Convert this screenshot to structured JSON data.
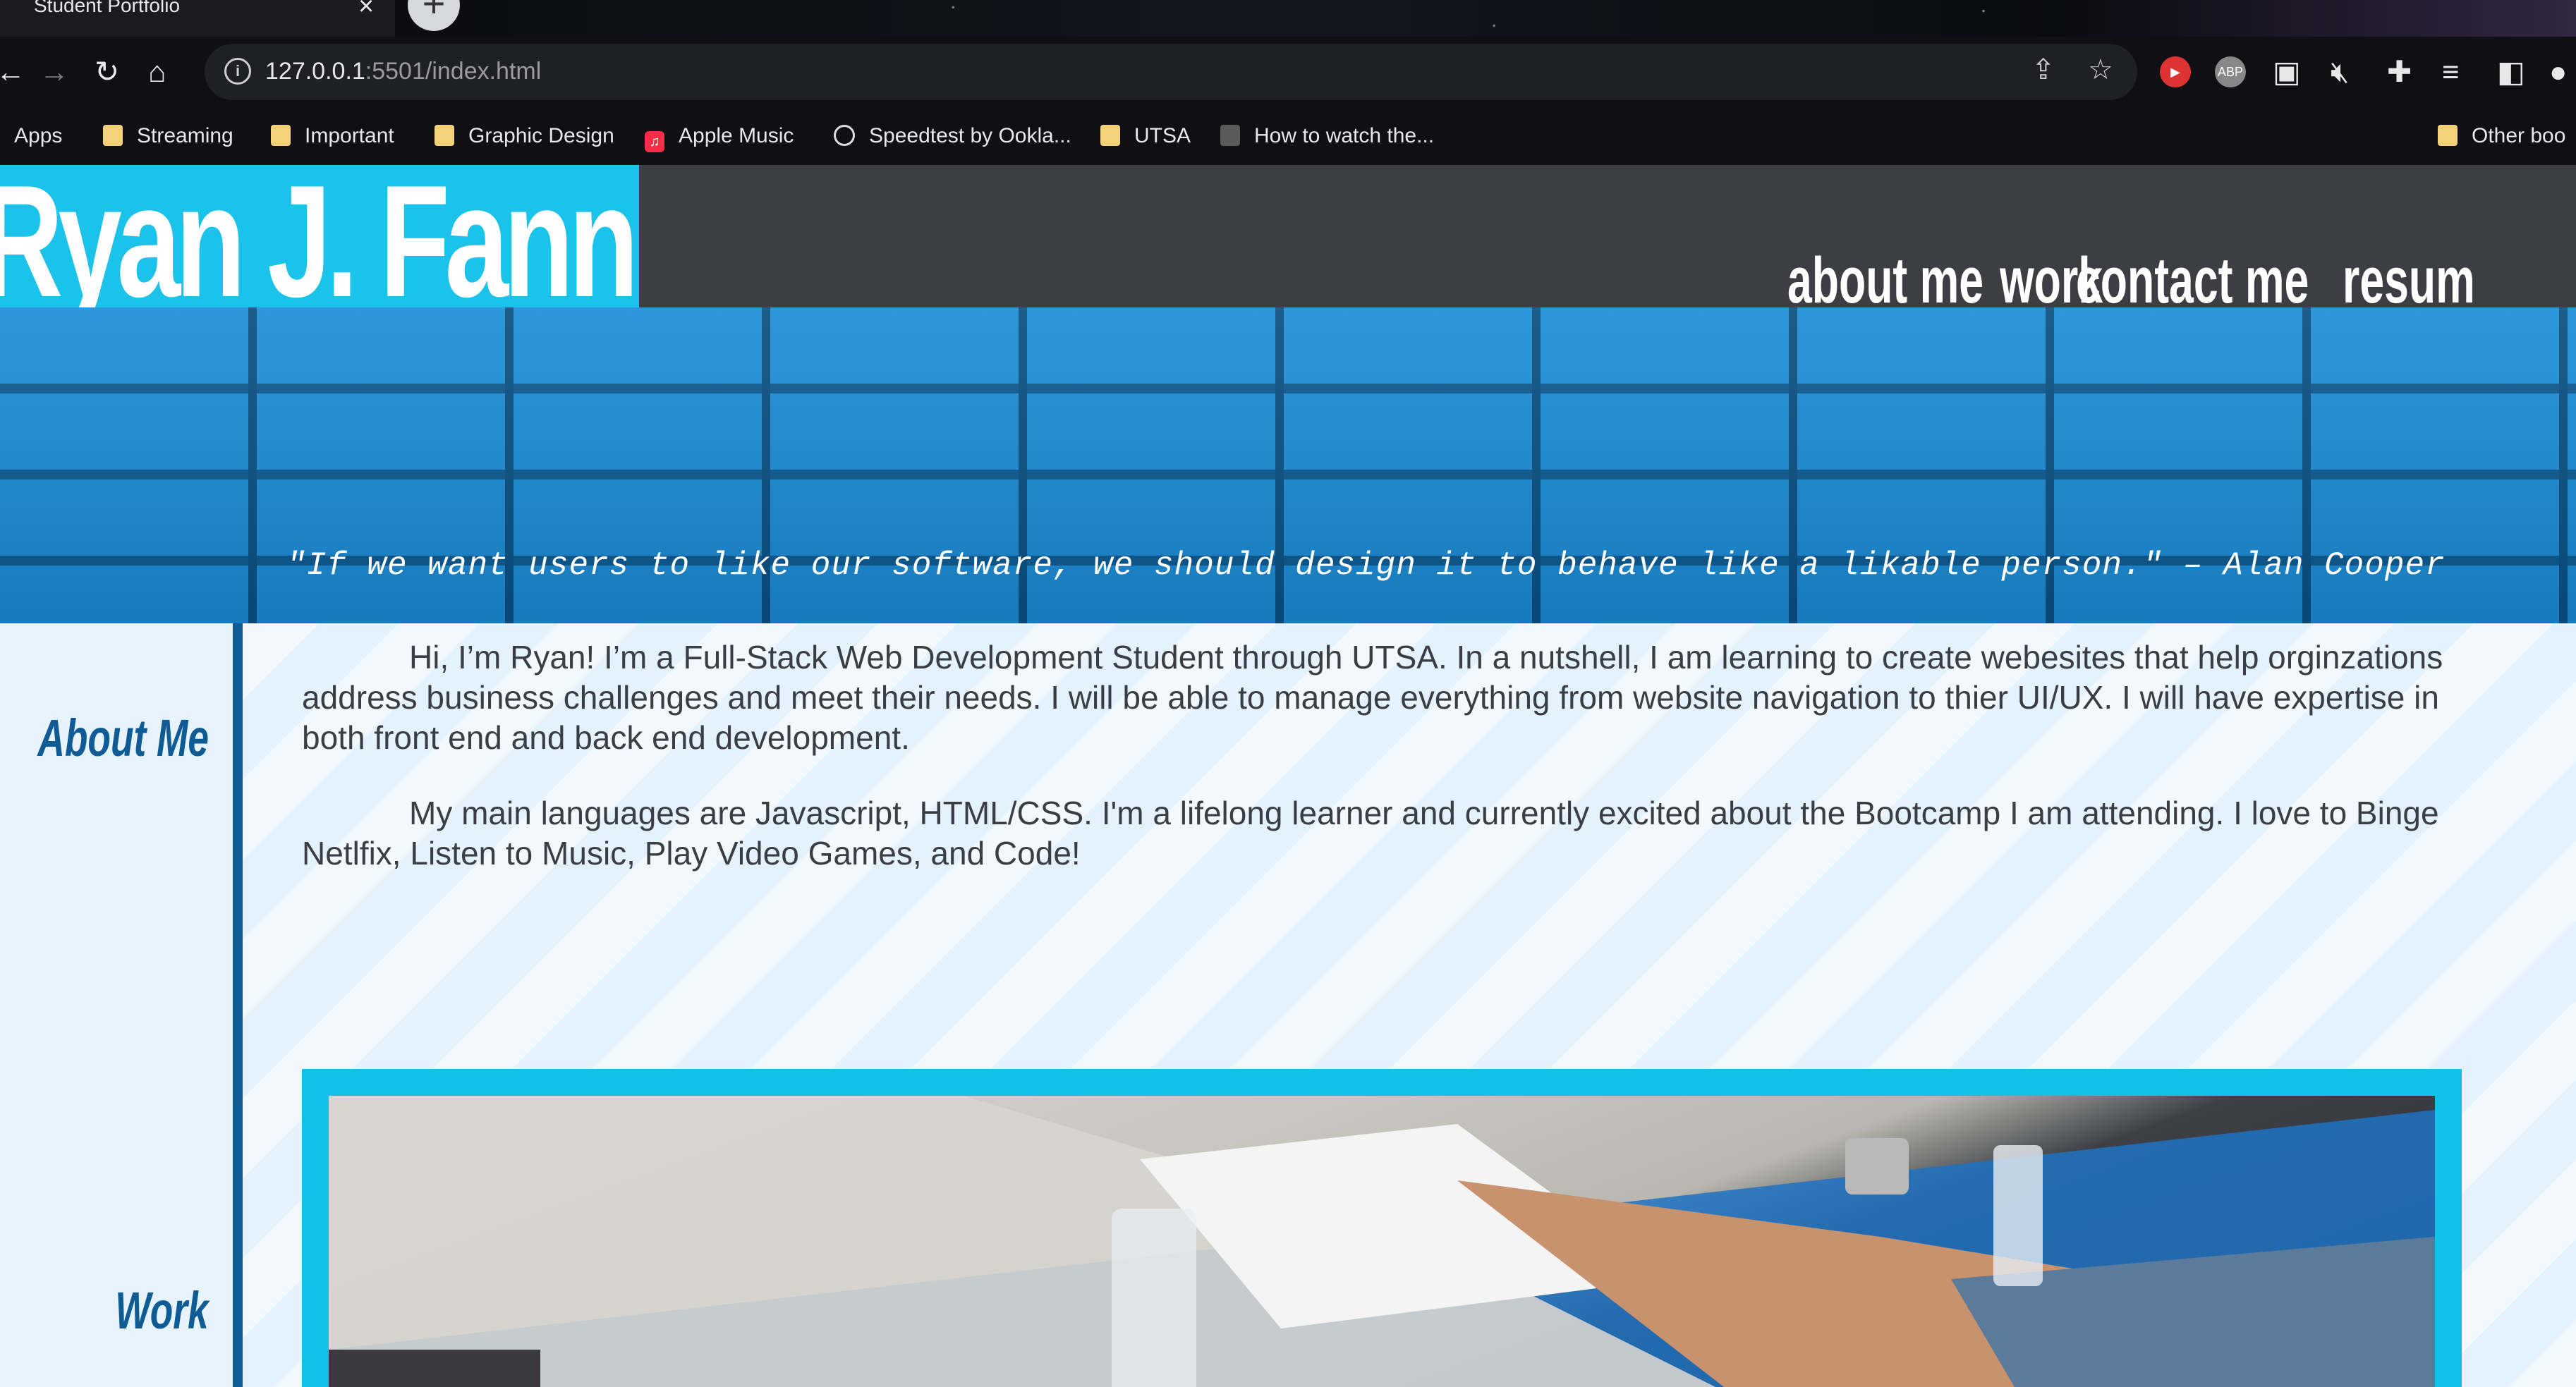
{
  "browser": {
    "tab_title": "Student Portfolio",
    "tab_close": "×",
    "new_tab": "+",
    "url_host": "127.0.0.1",
    "url_rest": ":5501/index.html",
    "info": "i",
    "ext_abp": "ABP"
  },
  "bookmarks": [
    {
      "label": "Apps",
      "icon": "apps-grid-icon"
    },
    {
      "label": "Streaming",
      "icon": "folder-icon"
    },
    {
      "label": "Important",
      "icon": "folder-icon"
    },
    {
      "label": "Graphic Design",
      "icon": "folder-icon"
    },
    {
      "label": "Apple Music",
      "icon": "apple-music-icon"
    },
    {
      "label": "Speedtest by Ookla...",
      "icon": "speedtest-icon"
    },
    {
      "label": "UTSA",
      "icon": "folder-icon"
    },
    {
      "label": "How to watch the...",
      "icon": "site-icon"
    },
    {
      "label": "Other boo",
      "icon": "folder-icon"
    }
  ],
  "site": {
    "name": "Ryan J. Fann",
    "nav": [
      "about me",
      "work",
      "contact me",
      "resum"
    ],
    "quote": "\"If we want users to like our software, we should design it to behave like a likable person.\" – Alan Cooper",
    "sidebar": [
      "About Me",
      "Work"
    ],
    "about_p1": "Hi, I’m Ryan! I’m a Full-Stack Web Development Student through UTSA. In a nutshell, I am learning to create webesites that help orginzations address business challenges and meet their needs. I will be able to manage everything from website navigation to thier UI/UX. I will have expertise in both front end and back end development.",
    "about_p2": "My main languages are Javascript, HTML/CSS. I'm a lifelong learner and currently excited about the Bootcamp I am attending. I love to Binge Netlfix, Listen to Music, Play Video Games, and Code!"
  },
  "colors": {
    "accent": "#1bc3ea",
    "header": "#3d3d44",
    "heading": "#0f5b95"
  }
}
